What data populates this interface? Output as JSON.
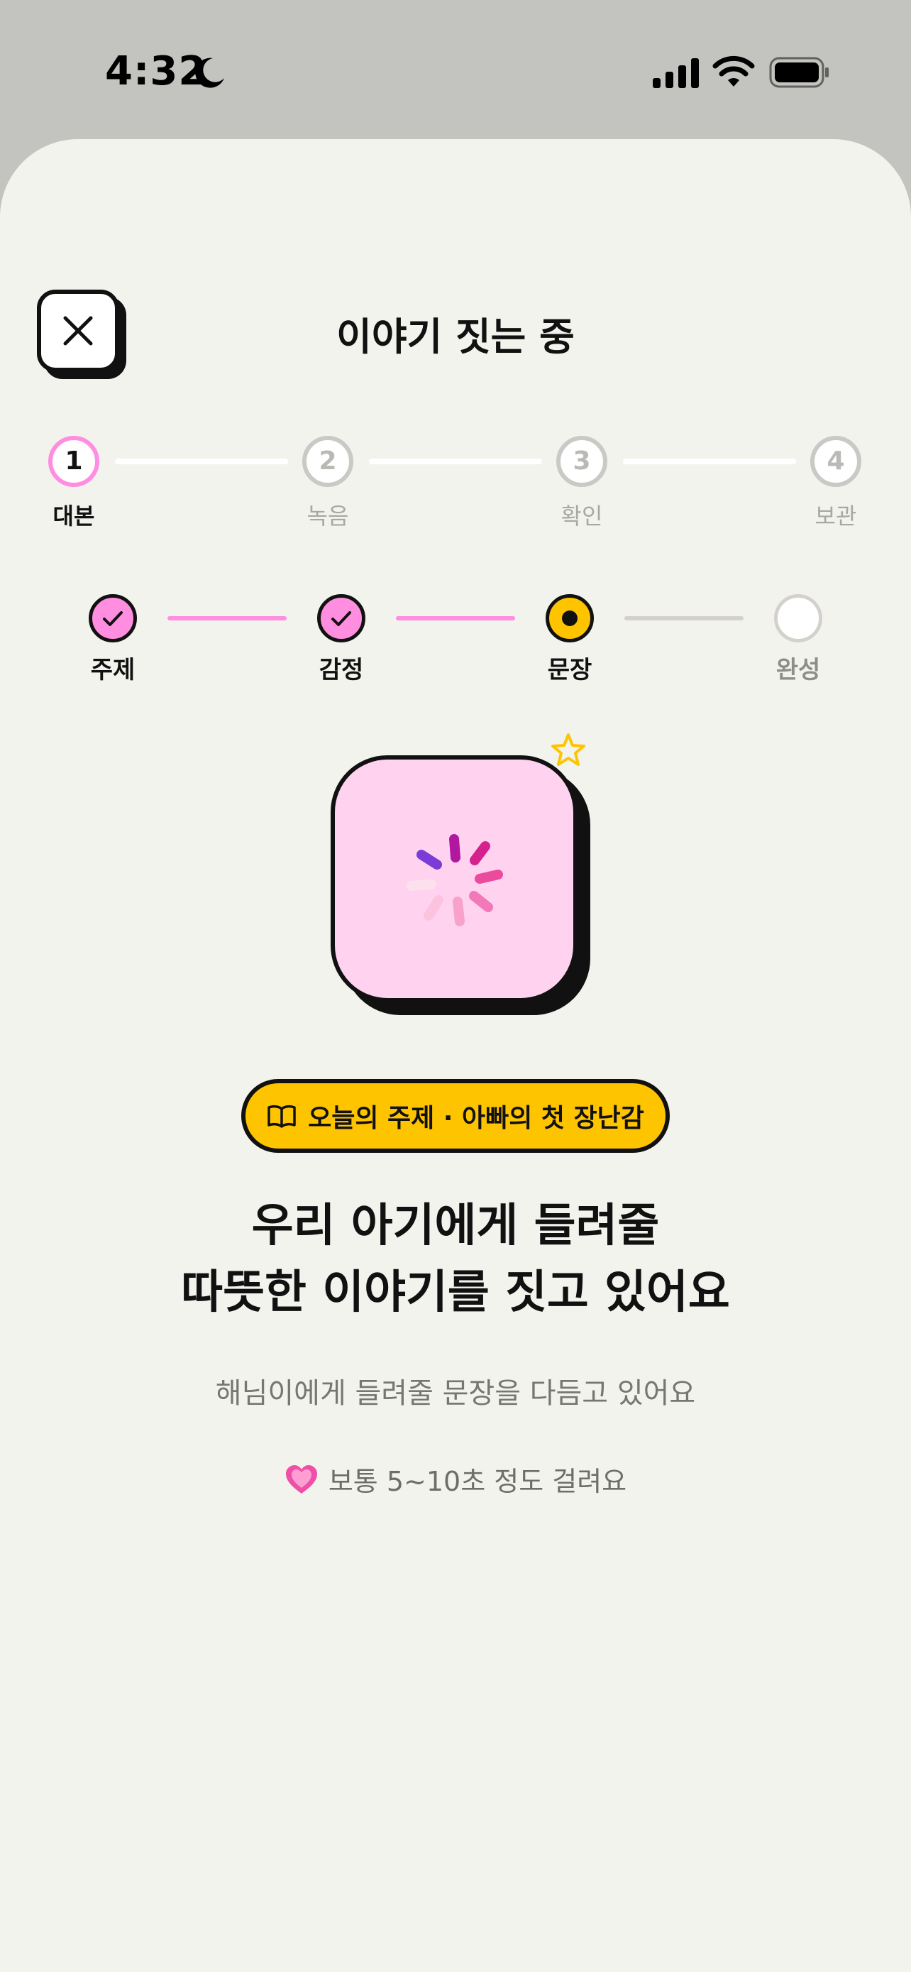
{
  "status": {
    "time": "4:32"
  },
  "header": {
    "title": "이야기 짓는 중",
    "close_icon": "close-icon"
  },
  "steps": [
    {
      "num": "1",
      "label": "대본",
      "state": "active"
    },
    {
      "num": "2",
      "label": "녹음",
      "state": "pending"
    },
    {
      "num": "3",
      "label": "확인",
      "state": "pending"
    },
    {
      "num": "4",
      "label": "보관",
      "state": "pending"
    }
  ],
  "substeps": [
    {
      "label": "주제",
      "state": "done"
    },
    {
      "label": "감정",
      "state": "done"
    },
    {
      "label": "문장",
      "state": "current"
    },
    {
      "label": "완성",
      "state": "pending"
    }
  ],
  "topic": {
    "icon": "book-icon",
    "text": "오늘의 주제 · 아빠의 첫 장난감"
  },
  "headline": {
    "line1": "우리 아기에게 들려줄",
    "line2": "따뜻한 이야기를 짓고 있어요"
  },
  "subtext": "해님이에게 들려줄 문장을 다듬고 있어요",
  "hint": {
    "icon": "heart-icon",
    "text": "보통 5~10초 정도 걸려요"
  },
  "colors": {
    "pink": "#ff8ee0",
    "yellow": "#ffc400",
    "card": "#ffd3f0",
    "background": "#f3f3ee"
  }
}
